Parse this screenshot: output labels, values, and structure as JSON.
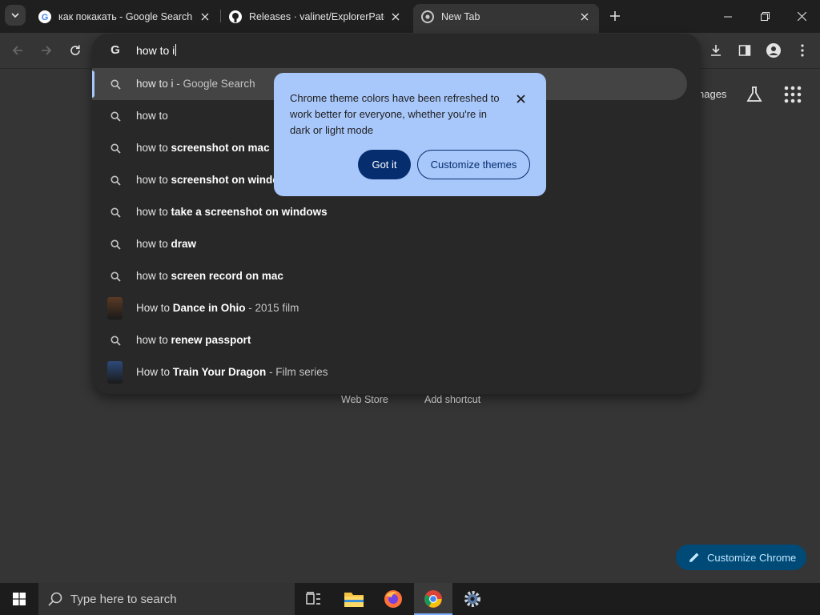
{
  "tabs": [
    {
      "title": "как покакать - Google Search",
      "favicon": "google-g-icon",
      "active": false
    },
    {
      "title": "Releases · valinet/ExplorerPatcher",
      "favicon": "github-icon",
      "active": false
    },
    {
      "title": "New Tab",
      "favicon": "chrome-icon",
      "active": true
    }
  ],
  "omnibox": {
    "input_value": "how to i",
    "suggestions": [
      {
        "prefix": "how to i",
        "bold": "",
        "desc": " - Google Search",
        "icon": "search-icon",
        "selected": true
      },
      {
        "prefix": "how to",
        "bold": "",
        "desc": "",
        "icon": "search-icon"
      },
      {
        "prefix": "how to ",
        "bold": "screenshot on mac",
        "desc": "",
        "icon": "search-icon"
      },
      {
        "prefix": "how to ",
        "bold": "screenshot on windows",
        "desc": "",
        "icon": "search-icon"
      },
      {
        "prefix": "how to ",
        "bold": "take a screenshot on windows",
        "desc": "",
        "icon": "search-icon"
      },
      {
        "prefix": "how to ",
        "bold": "draw",
        "desc": "",
        "icon": "search-icon"
      },
      {
        "prefix": "how to ",
        "bold": "screen record on mac",
        "desc": "",
        "icon": "search-icon"
      },
      {
        "prefix": "How to ",
        "bold": "Dance in Ohio",
        "desc": " - 2015 film",
        "icon": "movie-thumbnail"
      },
      {
        "prefix": "how to ",
        "bold": "renew passport",
        "desc": "",
        "icon": "search-icon"
      },
      {
        "prefix": "How to ",
        "bold": "Train Your Dragon",
        "desc": " - Film series",
        "icon": "movie-thumbnail"
      }
    ]
  },
  "popup": {
    "message": "Chrome theme colors have been refreshed to work better for everyone, whether you're in dark or light mode",
    "got_it_label": "Got it",
    "customize_label": "Customize themes"
  },
  "ntp": {
    "images_label": "nages",
    "shortcut_labels": [
      "Web Store",
      "Add shortcut"
    ],
    "customize_chrome_label": "Customize Chrome"
  },
  "taskbar": {
    "search_placeholder": "Type here to search"
  },
  "colors": {
    "popup_bg": "#a8c7fa",
    "popup_button": "#062e6f",
    "accent": "#7cb0ff"
  }
}
